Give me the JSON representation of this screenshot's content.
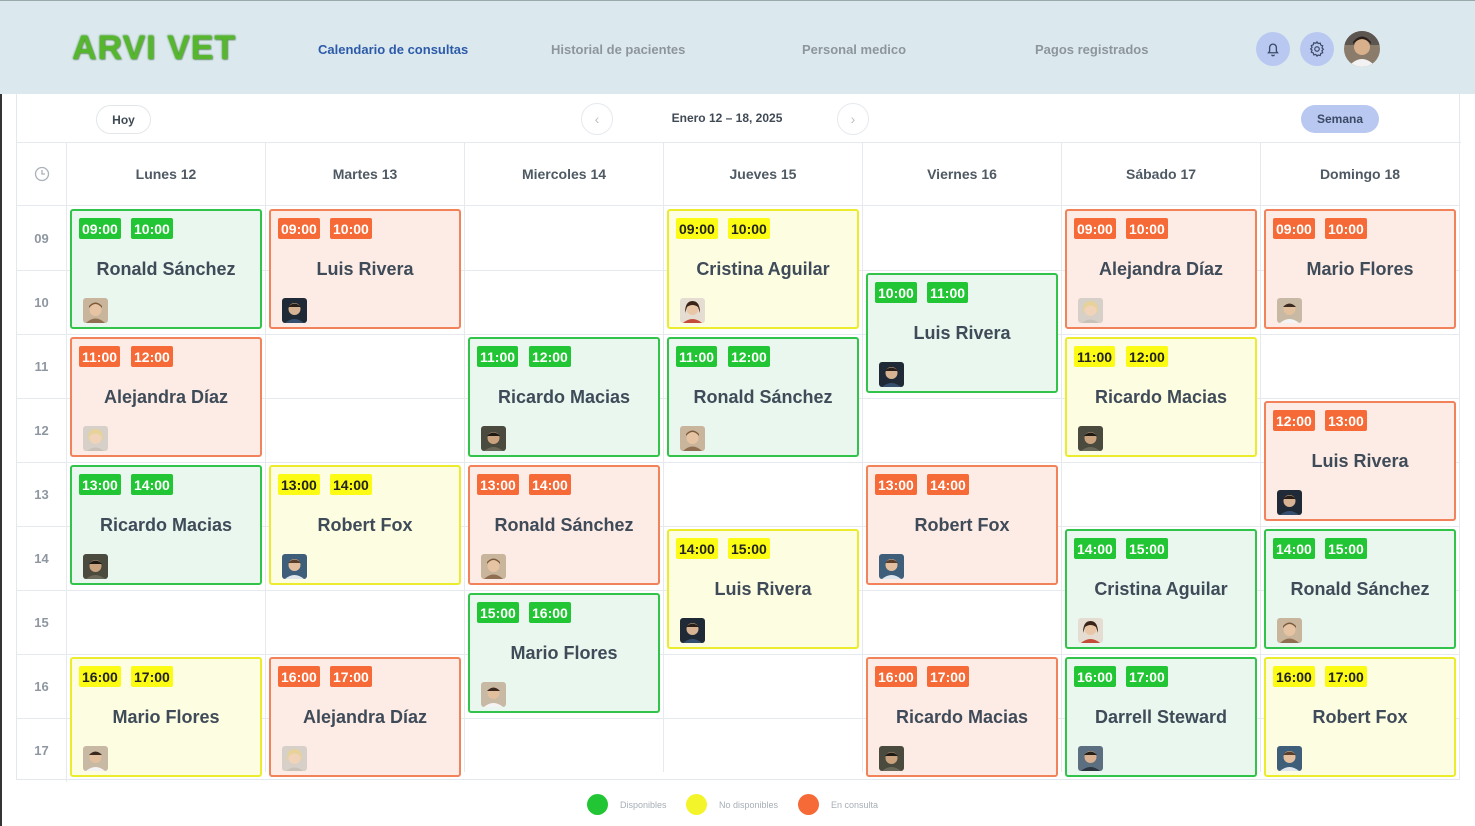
{
  "header": {
    "logo": "ARVI VET",
    "nav": [
      {
        "label": "Calendario de consultas",
        "active": true
      },
      {
        "label": "Historial de pacientes",
        "active": false
      },
      {
        "label": "Personal medico",
        "active": false
      },
      {
        "label": "Pagos registrados",
        "active": false
      }
    ],
    "icons": [
      "bell-icon",
      "gear-icon",
      "user-avatar"
    ]
  },
  "toolbar": {
    "today_label": "Hoy",
    "range_label": "Enero 12 – 18, 2025",
    "view_label": "Semana",
    "prev_icon": "chevron-left-icon",
    "next_icon": "chevron-right-icon"
  },
  "days": [
    "Lunes 12",
    "Martes 13",
    "Miercoles 14",
    "Jueves 15",
    "Viernes 16",
    "Sábado 17",
    "Domingo 18"
  ],
  "hours": [
    "09",
    "10",
    "11",
    "12",
    "13",
    "14",
    "15",
    "16",
    "17"
  ],
  "events": [
    {
      "day": 0,
      "start": 9,
      "end": "10:00",
      "from": "09:00",
      "name": "Ronald Sánchez",
      "status": "green",
      "avatar": "a"
    },
    {
      "day": 0,
      "start": 11,
      "end": "12:00",
      "from": "11:00",
      "name": "Alejandra Díaz",
      "status": "red",
      "avatar": "b"
    },
    {
      "day": 0,
      "start": 13,
      "end": "14:00",
      "from": "13:00",
      "name": "Ricardo Macias",
      "status": "green",
      "avatar": "c"
    },
    {
      "day": 0,
      "start": 16,
      "end": "17:00",
      "from": "16:00",
      "name": "Mario Flores",
      "status": "yellow",
      "avatar": "d"
    },
    {
      "day": 1,
      "start": 9,
      "end": "10:00",
      "from": "09:00",
      "name": "Luis Rivera",
      "status": "red",
      "avatar": "e"
    },
    {
      "day": 1,
      "start": 13,
      "end": "14:00",
      "from": "13:00",
      "name": "Robert Fox",
      "status": "yellow",
      "avatar": "f"
    },
    {
      "day": 1,
      "start": 16,
      "end": "17:00",
      "from": "16:00",
      "name": "Alejandra Díaz",
      "status": "red",
      "avatar": "b"
    },
    {
      "day": 2,
      "start": 11,
      "end": "12:00",
      "from": "11:00",
      "name": "Ricardo Macias",
      "status": "green",
      "avatar": "c"
    },
    {
      "day": 2,
      "start": 13,
      "end": "14:00",
      "from": "13:00",
      "name": "Ronald Sánchez",
      "status": "red",
      "avatar": "a"
    },
    {
      "day": 2,
      "start": 15,
      "end": "16:00",
      "from": "15:00",
      "name": "Mario Flores",
      "status": "green",
      "avatar": "d"
    },
    {
      "day": 3,
      "start": 9,
      "end": "10:00",
      "from": "09:00",
      "name": "Cristina Aguilar",
      "status": "yellow",
      "avatar": "g"
    },
    {
      "day": 3,
      "start": 11,
      "end": "12:00",
      "from": "11:00",
      "name": "Ronald Sánchez",
      "status": "green",
      "avatar": "a"
    },
    {
      "day": 3,
      "start": 14,
      "end": "15:00",
      "from": "14:00",
      "name": "Luis Rivera",
      "status": "yellow",
      "avatar": "e"
    },
    {
      "day": 4,
      "start": 10,
      "end": "11:00",
      "from": "10:00",
      "name": "Luis Rivera",
      "status": "green",
      "avatar": "e"
    },
    {
      "day": 4,
      "start": 13,
      "end": "14:00",
      "from": "13:00",
      "name": "Robert Fox",
      "status": "red",
      "avatar": "f"
    },
    {
      "day": 4,
      "start": 16,
      "end": "17:00",
      "from": "16:00",
      "name": "Ricardo Macias",
      "status": "red",
      "avatar": "c"
    },
    {
      "day": 5,
      "start": 9,
      "end": "10:00",
      "from": "09:00",
      "name": "Alejandra Díaz",
      "status": "red",
      "avatar": "b"
    },
    {
      "day": 5,
      "start": 11,
      "end": "12:00",
      "from": "11:00",
      "name": "Ricardo Macias",
      "status": "yellow",
      "avatar": "c"
    },
    {
      "day": 5,
      "start": 14,
      "end": "15:00",
      "from": "14:00",
      "name": "Cristina Aguilar",
      "status": "green",
      "avatar": "g"
    },
    {
      "day": 5,
      "start": 16,
      "end": "17:00",
      "from": "16:00",
      "name": "Darrell Steward",
      "status": "green",
      "avatar": "h"
    },
    {
      "day": 6,
      "start": 9,
      "end": "10:00",
      "from": "09:00",
      "name": "Mario Flores",
      "status": "red",
      "avatar": "d"
    },
    {
      "day": 6,
      "start": 12,
      "end": "13:00",
      "from": "12:00",
      "name": "Luis Rivera",
      "status": "red",
      "avatar": "e"
    },
    {
      "day": 6,
      "start": 14,
      "end": "15:00",
      "from": "14:00",
      "name": "Ronald Sánchez",
      "status": "green",
      "avatar": "a"
    },
    {
      "day": 6,
      "start": 16,
      "end": "17:00",
      "from": "16:00",
      "name": "Robert Fox",
      "status": "yellow",
      "avatar": "f"
    }
  ],
  "legend": [
    {
      "label": "Disponibles",
      "color": "#22c534"
    },
    {
      "label": "No disponibles",
      "color": "#f4f42a"
    },
    {
      "label": "En consulta",
      "color": "#f56a37"
    }
  ],
  "colors": {
    "green": "#22c534",
    "yellow": "#fbfb14",
    "red": "#f56a37",
    "header_bg": "#dbe9ef",
    "logo": "#56b62e"
  }
}
